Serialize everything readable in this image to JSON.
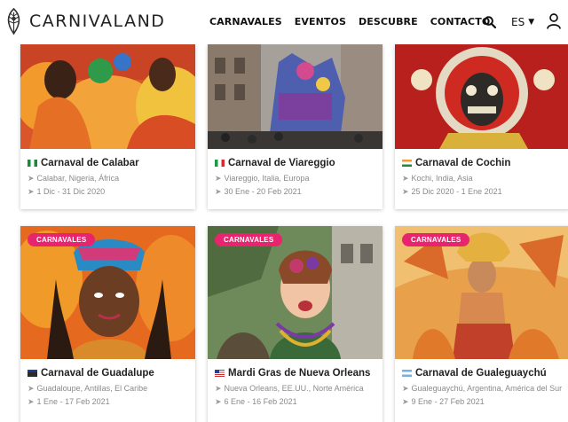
{
  "header": {
    "brand": "CARNIVALAND",
    "nav": [
      "CARNAVALES",
      "EVENTOS",
      "DESCUBRE",
      "CONTACTO"
    ],
    "language": "ES",
    "icons": [
      "feather-logo-icon",
      "search-icon",
      "chevron-down-icon",
      "user-icon"
    ]
  },
  "cards": [
    {
      "title": "Carnaval de Calabar",
      "location": "Calabar, Nigeria, África",
      "dates": "1 Dic - 31 Dic 2020",
      "badge": "",
      "flag": "nigeria"
    },
    {
      "title": "Carnaval de Viareggio",
      "location": "Viareggio, Italia, Europa",
      "dates": "30 Ene - 20 Feb 2021",
      "badge": "",
      "flag": "italy"
    },
    {
      "title": "Carnaval de Cochin",
      "location": "Kochi, India, Asia",
      "dates": "25 Dic 2020 - 1 Ene 2021",
      "badge": "",
      "flag": "india"
    },
    {
      "title": "Carnaval de Guadalupe",
      "location": "Guadaloupe, Antillas, El Caribe",
      "dates": "1 Ene - 17 Feb 2021",
      "badge": "CARNAVALES",
      "flag": "guadeloupe"
    },
    {
      "title": "Mardi Gras de Nueva Orleans",
      "location": "Nueva Orleans, EE.UU., Norte América",
      "dates": "6 Ene - 16 Feb 2021",
      "badge": "CARNAVALES",
      "flag": "usa"
    },
    {
      "title": "Carnaval de Gualeguaychú",
      "location": "Gualeguaychú, Argentina, América del Sur",
      "dates": "9 Ene - 27 Feb 2021",
      "badge": "CARNAVALES",
      "flag": "argentina"
    }
  ],
  "colors": {
    "badge": "#e8246e",
    "meta_text": "#8a8a8a",
    "title_text": "#222222"
  }
}
